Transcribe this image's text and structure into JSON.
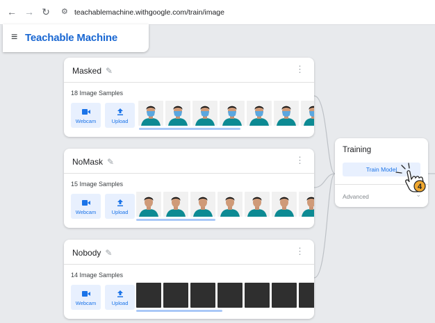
{
  "browser": {
    "url": "teachablemachine.withgoogle.com/train/image",
    "icons": {
      "back": "arrow-left-icon",
      "forward": "arrow-right-icon",
      "reload": "reload-icon",
      "site": "site-settings-icon"
    }
  },
  "app": {
    "title": "Teachable Machine",
    "menu_icon": "hamburger-menu-icon"
  },
  "classes": [
    {
      "name": "Masked",
      "samples_label": "18 Image Samples",
      "webcam_label": "Webcam",
      "upload_label": "Upload",
      "thumbnail_kind": "face-with-mask"
    },
    {
      "name": "NoMask",
      "samples_label": "15 Image Samples",
      "webcam_label": "Webcam",
      "upload_label": "Upload",
      "thumbnail_kind": "face"
    },
    {
      "name": "Nobody",
      "samples_label": "14 Image Samples",
      "webcam_label": "Webcam",
      "upload_label": "Upload",
      "thumbnail_kind": "dark-frame"
    }
  ],
  "training": {
    "title": "Training",
    "train_button": "Train Model",
    "advanced_label": "Advanced"
  },
  "annotation": {
    "step_number": "4"
  },
  "colors": {
    "accent": "#1a73e8",
    "accent_light": "#e8f0fe",
    "shirt": "#0d8a93",
    "pointer_badge": "#f0a830"
  }
}
